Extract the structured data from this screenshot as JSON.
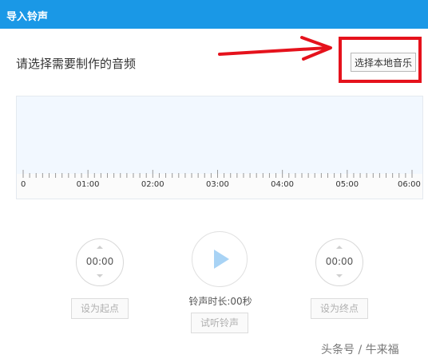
{
  "window": {
    "title": "导入铃声"
  },
  "prompt": "请选择需要制作的音频",
  "select_button": "选择本地音乐",
  "timeline": {
    "labels": [
      "0",
      "01:00",
      "02:00",
      "03:00",
      "04:00",
      "05:00",
      "06:00"
    ]
  },
  "start": {
    "value": "00:00",
    "button": "设为起点"
  },
  "end": {
    "value": "00:00",
    "button": "设为终点"
  },
  "duration_text": "铃声时长:00秒",
  "preview_button": "试听铃声",
  "watermark": "头条号 / 牛来福",
  "colors": {
    "titlebar": "#1a98e6",
    "annotation_red": "#e5121c",
    "play_icon": "#a8d3f5"
  }
}
